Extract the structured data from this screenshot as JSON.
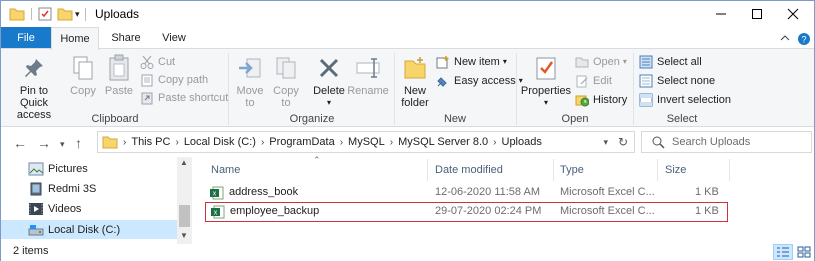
{
  "window": {
    "title": "Uploads",
    "buttons": {
      "minimize": "—",
      "maximize": "☐",
      "close": "✕"
    }
  },
  "ribbon_tabs": [
    "File",
    "Home",
    "Share",
    "View"
  ],
  "ribbon": {
    "clipboard": {
      "label": "Clipboard",
      "pin": "Pin to Quick access",
      "pin_line1": "Pin to Quick",
      "pin_line2": "access",
      "copy": "Copy",
      "paste": "Paste",
      "cut": "Cut",
      "copy_path": "Copy path",
      "paste_shortcut": "Paste shortcut"
    },
    "organize": {
      "label": "Organize",
      "move_to": "Move to",
      "move_line1": "Move",
      "move_line2": "to",
      "copy_to": "Copy to",
      "copy_line1": "Copy",
      "copy_line2": "to",
      "delete": "Delete",
      "rename": "Rename"
    },
    "new": {
      "label": "New",
      "new_folder_line1": "New",
      "new_folder_line2": "folder",
      "new_item": "New item",
      "easy_access": "Easy access"
    },
    "open": {
      "label": "Open",
      "properties": "Properties",
      "open": "Open",
      "edit": "Edit",
      "history": "History"
    },
    "select": {
      "label": "Select",
      "select_all": "Select all",
      "select_none": "Select none",
      "invert_selection": "Invert selection"
    }
  },
  "address": {
    "crumbs": [
      "This PC",
      "Local Disk (C:)",
      "ProgramData",
      "MySQL",
      "MySQL Server 8.0",
      "Uploads"
    ],
    "search_placeholder": "Search Uploads"
  },
  "nav_pane": {
    "items": [
      {
        "label": "Pictures",
        "icon": "pictures-icon"
      },
      {
        "label": "Redmi 3S",
        "icon": "phone-icon"
      },
      {
        "label": "Videos",
        "icon": "videos-icon"
      },
      {
        "label": "Local Disk (C:)",
        "icon": "disk-icon",
        "selected": true
      }
    ]
  },
  "file_list": {
    "columns": {
      "name": "Name",
      "date": "Date modified",
      "type": "Type",
      "size": "Size"
    },
    "rows": [
      {
        "name": "address_book",
        "date": "12-06-2020 11:58 AM",
        "type": "Microsoft Excel C...",
        "size": "1 KB",
        "selected": false
      },
      {
        "name": "employee_backup",
        "date": "29-07-2020 02:24 PM",
        "type": "Microsoft Excel C...",
        "size": "1 KB",
        "selected": true
      }
    ]
  },
  "status": {
    "item_count": "2 items"
  },
  "colors": {
    "accent": "#1979ca",
    "selection_border": "#d2303a",
    "nav_selected": "#cce8ff"
  }
}
